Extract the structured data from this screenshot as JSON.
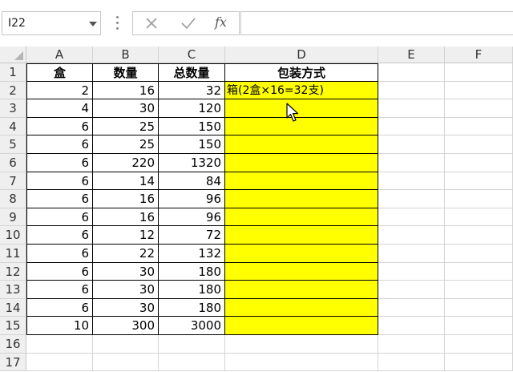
{
  "name_box": {
    "value": "I22"
  },
  "formula_bar": {
    "cancel_icon": "close-icon",
    "enter_icon": "check-icon",
    "fx_label": "fx",
    "value": ""
  },
  "columns": [
    "A",
    "B",
    "C",
    "D",
    "E",
    "F"
  ],
  "rows": [
    "1",
    "2",
    "3",
    "4",
    "5",
    "6",
    "7",
    "8",
    "9",
    "10",
    "11",
    "12",
    "13",
    "14",
    "15",
    "16",
    "17"
  ],
  "headers": {
    "A": "盒",
    "B": "数量",
    "C": "总数量",
    "D": "包装方式"
  },
  "data_rows": [
    {
      "A": "2",
      "B": "16",
      "C": "32",
      "D": "箱(2盒×16=32支)"
    },
    {
      "A": "4",
      "B": "30",
      "C": "120",
      "D": ""
    },
    {
      "A": "6",
      "B": "25",
      "C": "150",
      "D": ""
    },
    {
      "A": "6",
      "B": "25",
      "C": "150",
      "D": ""
    },
    {
      "A": "6",
      "B": "220",
      "C": "1320",
      "D": ""
    },
    {
      "A": "6",
      "B": "14",
      "C": "84",
      "D": ""
    },
    {
      "A": "6",
      "B": "16",
      "C": "96",
      "D": ""
    },
    {
      "A": "6",
      "B": "16",
      "C": "96",
      "D": ""
    },
    {
      "A": "6",
      "B": "12",
      "C": "72",
      "D": ""
    },
    {
      "A": "6",
      "B": "22",
      "C": "132",
      "D": ""
    },
    {
      "A": "6",
      "B": "30",
      "C": "180",
      "D": ""
    },
    {
      "A": "6",
      "B": "30",
      "C": "180",
      "D": ""
    },
    {
      "A": "6",
      "B": "30",
      "C": "180",
      "D": ""
    },
    {
      "A": "10",
      "B": "300",
      "C": "3000",
      "D": ""
    }
  ],
  "colors": {
    "highlight": "#ffff00",
    "header_bg": "#efefef",
    "gridline": "#d4d4d4",
    "border": "#000000"
  }
}
